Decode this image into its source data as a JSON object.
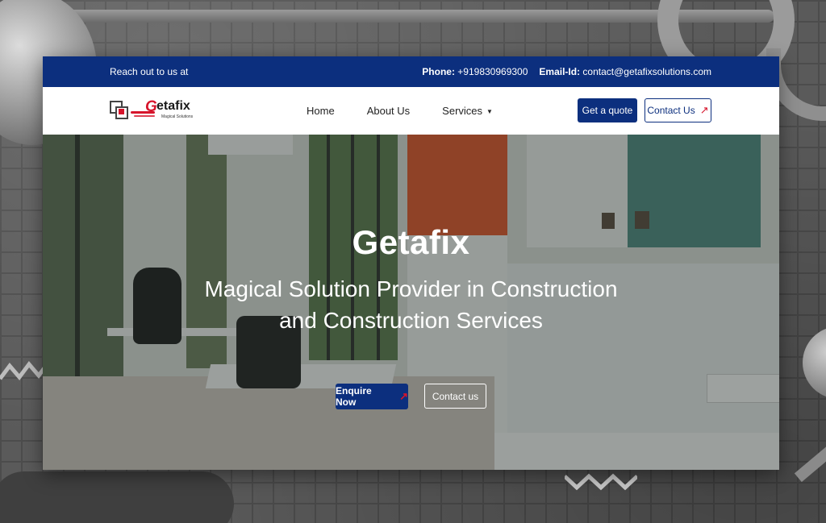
{
  "topbar": {
    "reach_text": "Reach out to us at",
    "phone_label": "Phone:",
    "phone_value": "+919830969300",
    "email_label": "Email-Id:",
    "email_value": "contact@getafixsolutions.com"
  },
  "logo": {
    "g": "G",
    "word": "etafix",
    "tagline": "Magical Solutions"
  },
  "nav": {
    "items": [
      {
        "label": "Home"
      },
      {
        "label": "About Us"
      },
      {
        "label": "Services",
        "icon": "caret-down-icon"
      }
    ],
    "quote_button": "Get a quote",
    "contact_button": "Contact Us",
    "contact_icon": "arrow-up-right-icon"
  },
  "hero": {
    "title": "Getafix",
    "subtitle": "Magical Solution Provider in Construction and Construction Services",
    "enquire_button": "Enquire Now",
    "enquire_icon": "arrow-up-right-icon",
    "contact_button": "Contact us"
  },
  "colors": {
    "primary": "#0c2f7e",
    "accent": "#d6142b",
    "background": "#5a5a5a"
  }
}
